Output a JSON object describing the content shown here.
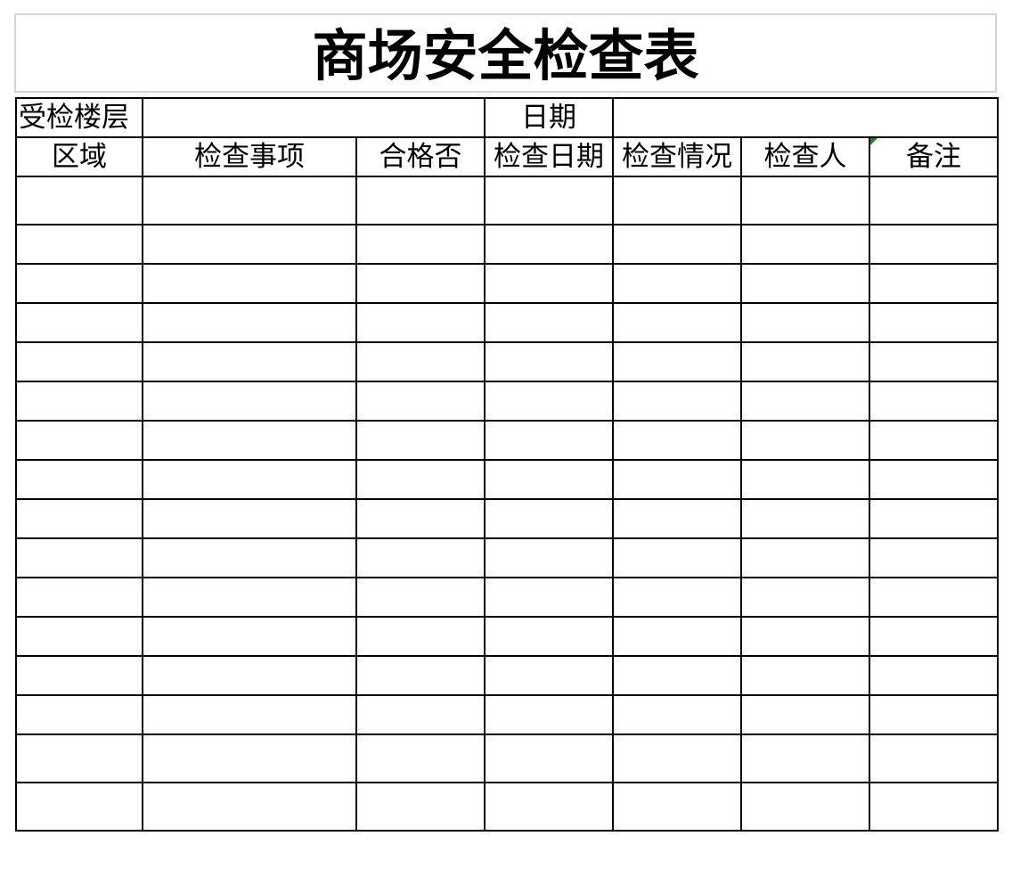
{
  "title": "商场安全检查表",
  "info_row": {
    "floor_label": "受检楼层",
    "floor_value": "",
    "date_label": "日期",
    "date_value": ""
  },
  "columns": [
    "区域",
    "检查事项",
    "合格否",
    "检查日期",
    "检查情况",
    "检查人",
    "备注"
  ],
  "rows": [
    [
      "",
      "",
      "",
      "",
      "",
      "",
      ""
    ],
    [
      "",
      "",
      "",
      "",
      "",
      "",
      ""
    ],
    [
      "",
      "",
      "",
      "",
      "",
      "",
      ""
    ],
    [
      "",
      "",
      "",
      "",
      "",
      "",
      ""
    ],
    [
      "",
      "",
      "",
      "",
      "",
      "",
      ""
    ],
    [
      "",
      "",
      "",
      "",
      "",
      "",
      ""
    ],
    [
      "",
      "",
      "",
      "",
      "",
      "",
      ""
    ],
    [
      "",
      "",
      "",
      "",
      "",
      "",
      ""
    ],
    [
      "",
      "",
      "",
      "",
      "",
      "",
      ""
    ],
    [
      "",
      "",
      "",
      "",
      "",
      "",
      ""
    ],
    [
      "",
      "",
      "",
      "",
      "",
      "",
      ""
    ],
    [
      "",
      "",
      "",
      "",
      "",
      "",
      ""
    ],
    [
      "",
      "",
      "",
      "",
      "",
      "",
      ""
    ],
    [
      "",
      "",
      "",
      "",
      "",
      "",
      ""
    ],
    [
      "",
      "",
      "",
      "",
      "",
      "",
      ""
    ],
    [
      "",
      "",
      "",
      "",
      "",
      "",
      ""
    ]
  ],
  "colors": {
    "grid": "#000000",
    "title_border": "#d4d4d4",
    "comment_marker": "#1e8a1e"
  }
}
